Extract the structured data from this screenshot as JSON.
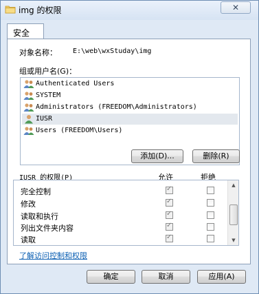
{
  "window": {
    "title": "img 的权限",
    "close_glyph": "✕"
  },
  "tabs": [
    {
      "label": "安全"
    }
  ],
  "object": {
    "label": "对象名称：",
    "value": "E:\\web\\wxStuday\\img"
  },
  "groups": {
    "label": "组或用户名(G)：",
    "items": [
      {
        "name": "Authenticated Users",
        "icon": "users-icon"
      },
      {
        "name": "SYSTEM",
        "icon": "users-icon"
      },
      {
        "name": "Administrators (FREEDOM\\Administrators)",
        "icon": "users-icon"
      },
      {
        "name": "IUSR",
        "icon": "user-icon"
      },
      {
        "name": "Users (FREEDOM\\Users)",
        "icon": "users-icon"
      }
    ],
    "selected_index": 3,
    "add_label": "添加(D)...",
    "remove_label": "删除(R)"
  },
  "permissions": {
    "header": "IUSR 的权限(P)",
    "allow_header": "允许",
    "deny_header": "拒绝",
    "rows": [
      {
        "name": "完全控制",
        "allow": true,
        "deny": false
      },
      {
        "name": "修改",
        "allow": true,
        "deny": false
      },
      {
        "name": "读取和执行",
        "allow": true,
        "deny": false
      },
      {
        "name": "列出文件夹内容",
        "allow": true,
        "deny": false
      },
      {
        "name": "读取",
        "allow": true,
        "deny": false
      }
    ]
  },
  "help_link": "了解访问控制和权限",
  "buttons": {
    "ok": "确定",
    "cancel": "取消",
    "apply": "应用(A)"
  },
  "colors": {
    "window_bg": "#dfe9f5",
    "selection": "#e3e8ee",
    "link": "#0b5fb3"
  }
}
